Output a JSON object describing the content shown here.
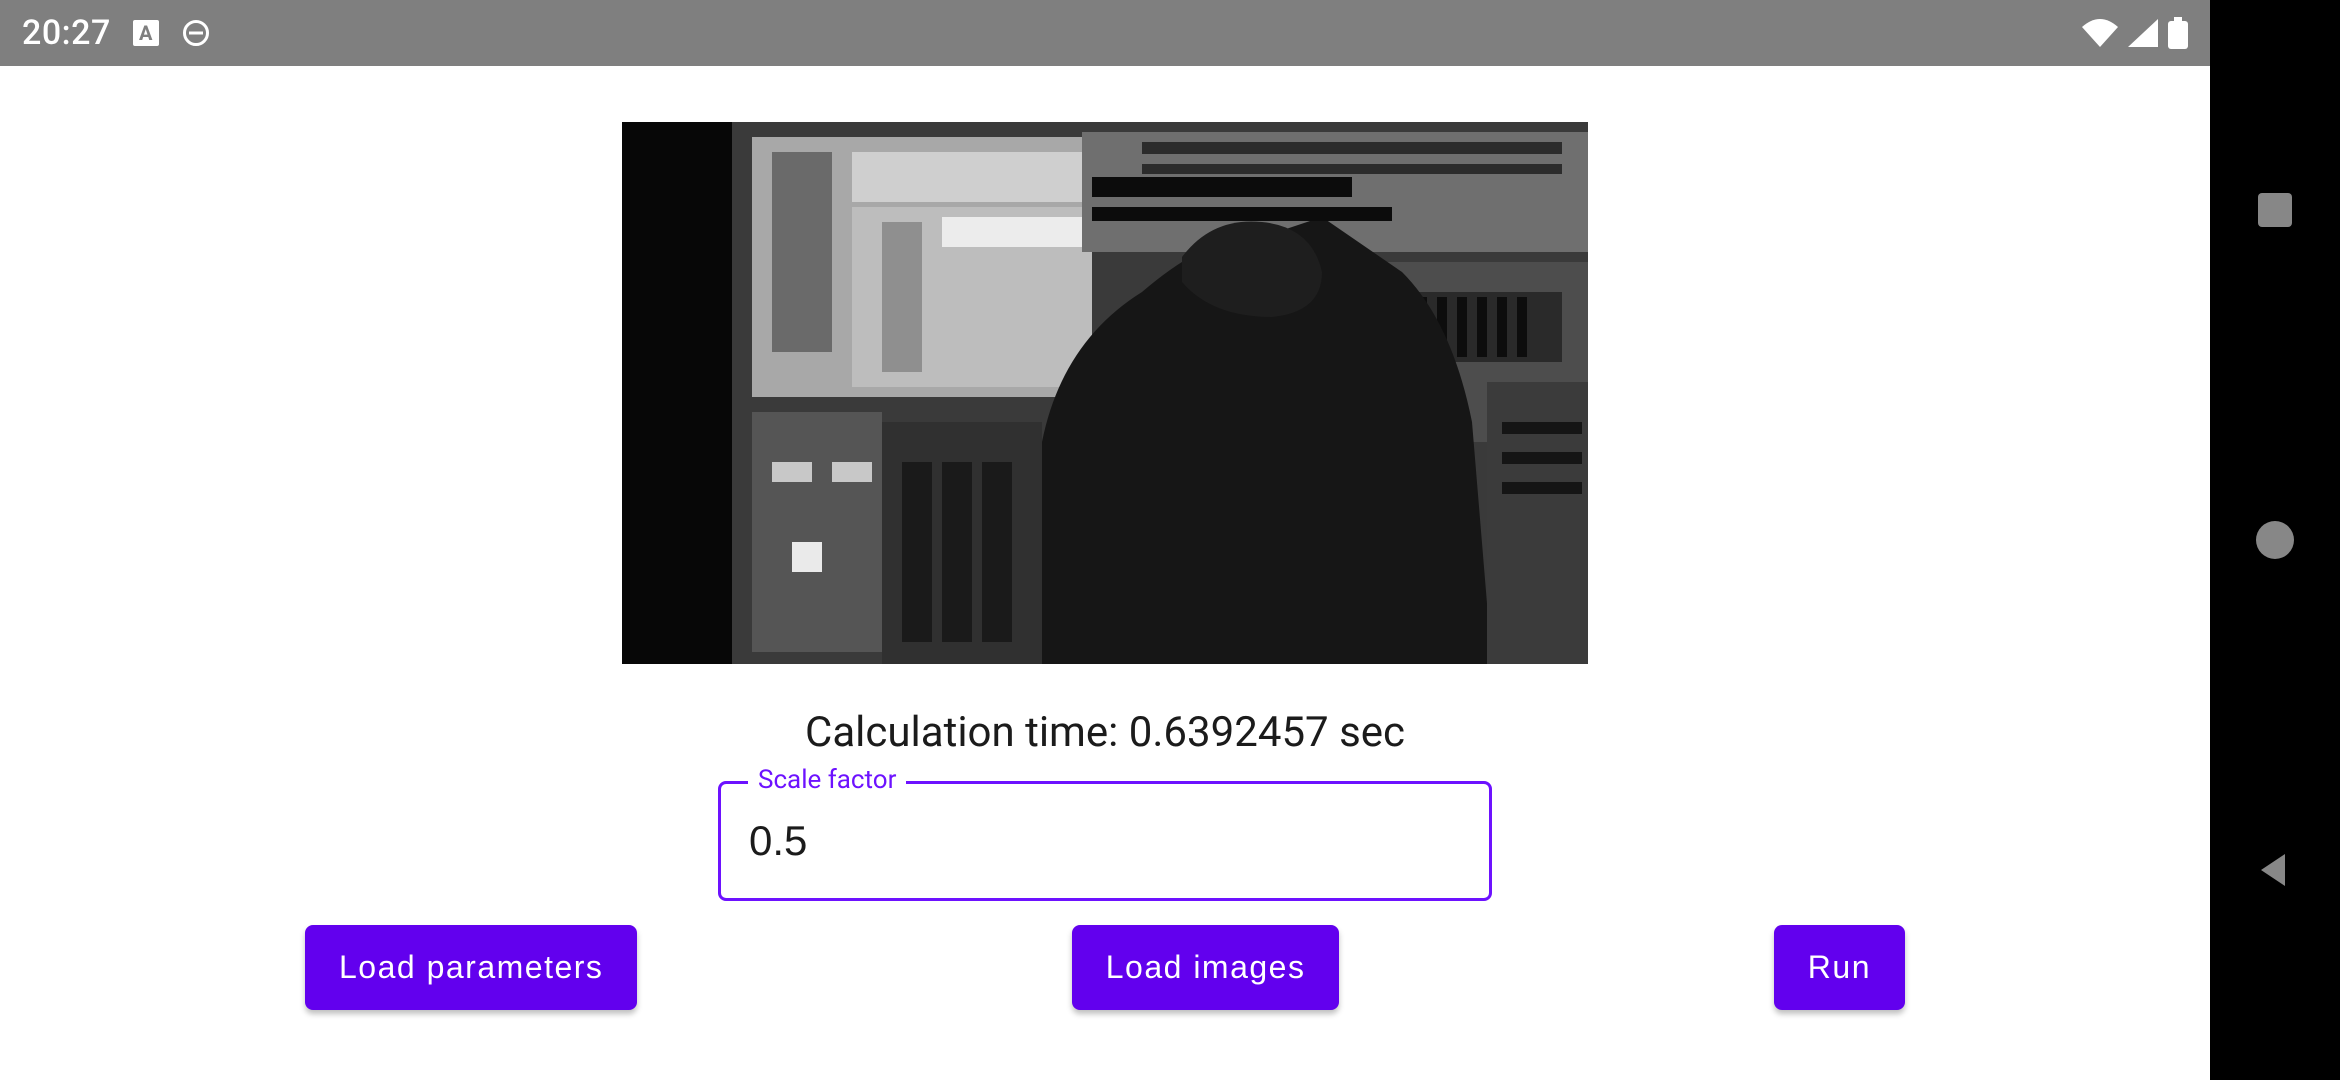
{
  "statusbar": {
    "time": "20:27"
  },
  "main": {
    "calculation_text": "Calculation time: 0.6392457 sec",
    "scale_field_label": "Scale factor",
    "scale_value": "0.5"
  },
  "buttons": {
    "load_parameters": "Load parameters",
    "load_images": "Load images",
    "run": "Run"
  },
  "colors": {
    "accent": "#6200ee",
    "field_border": "#6d12ff",
    "statusbar_bg": "#7f7f7f"
  }
}
